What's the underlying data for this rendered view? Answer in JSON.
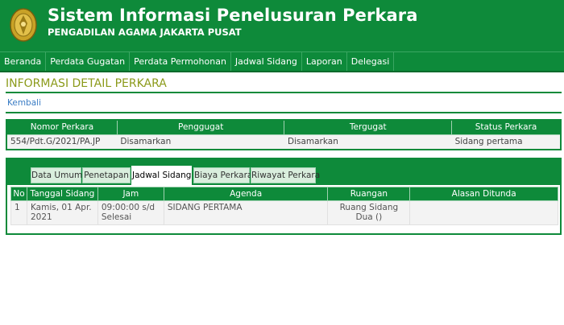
{
  "header": {
    "title": "Sistem Informasi Penelusuran Perkara",
    "subtitle": "PENGADILAN AGAMA JAKARTA PUSAT",
    "logo_icon": "court-emblem-icon"
  },
  "nav": {
    "items": [
      {
        "label": "Beranda"
      },
      {
        "label": "Perdata Gugatan"
      },
      {
        "label": "Perdata Permohonan"
      },
      {
        "label": "Jadwal Sidang"
      },
      {
        "label": "Laporan"
      },
      {
        "label": "Delegasi"
      }
    ]
  },
  "page": {
    "title": "INFORMASI DETAIL PERKARA",
    "back_link": "Kembali"
  },
  "case_table": {
    "headers": [
      "Nomor Perkara",
      "Penggugat",
      "Tergugat",
      "Status Perkara"
    ],
    "row": [
      "554/Pdt.G/2021/PA.JP",
      "Disamarkan",
      "Disamarkan",
      "Sidang pertama"
    ]
  },
  "tabs": {
    "items": [
      {
        "label": "Data Umum"
      },
      {
        "label": "Penetapan"
      },
      {
        "label": "Jadwal Sidang"
      },
      {
        "label": "Biaya Perkara"
      },
      {
        "label": "Riwayat Perkara"
      }
    ],
    "active": "Jadwal Sidang"
  },
  "schedule": {
    "headers": [
      "No",
      "Tanggal Sidang",
      "Jam",
      "Agenda",
      "Ruangan",
      "Alasan Ditunda"
    ],
    "rows": [
      {
        "no": "1",
        "tanggal": "Kamis, 01 Apr. 2021",
        "jam": "09:00:00 s/d Selesai",
        "agenda": "SIDANG PERTAMA",
        "ruangan": "Ruang Sidang Dua ()",
        "alasan": ""
      }
    ]
  },
  "colors": {
    "primary_green": "#0e8a3a",
    "title_olive": "#8b9a1a",
    "link_blue": "#3a7cc4"
  }
}
